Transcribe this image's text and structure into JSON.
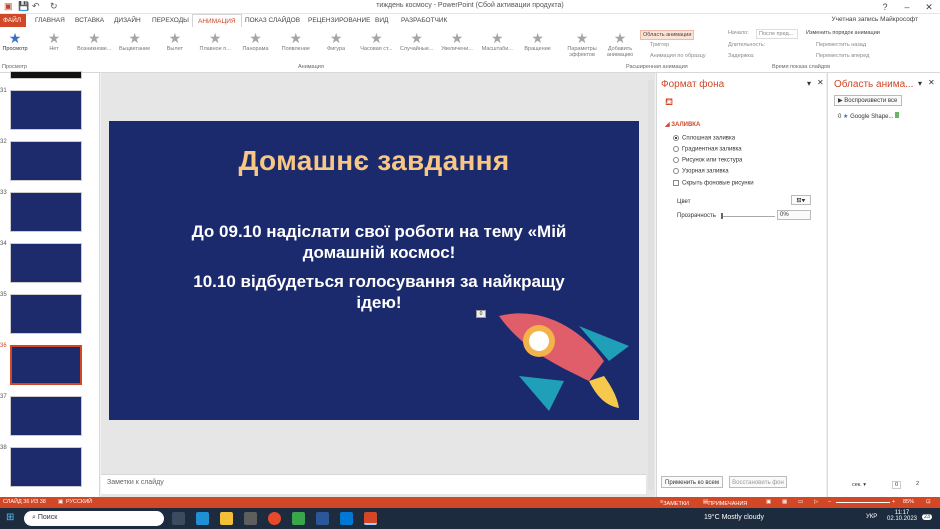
{
  "window": {
    "title": "тиждень космосу - PowerPoint (Сбой активации продукта)",
    "account": "Учетная запись Майкрософт"
  },
  "tabs": [
    "ФАЙЛ",
    "ГЛАВНАЯ",
    "ВСТАВКА",
    "ДИЗАЙН",
    "ПЕРЕХОДЫ",
    "АНИМАЦИЯ",
    "ПОКАЗ СЛАЙДОВ",
    "РЕЦЕНЗИРОВАНИЕ",
    "ВИД",
    "РАЗРАБОТЧИК"
  ],
  "ribbon": {
    "preview_label": "Просмотр",
    "preview_group": "Просмотр",
    "animations": [
      "Нет",
      "Возникнове...",
      "Выцветание",
      "Вылет",
      "Плавное п...",
      "Панорама",
      "Появление",
      "Фигура",
      "Часовая ст...",
      "Случайные...",
      "Увеличени...",
      "Масштаби...",
      "Вращение"
    ],
    "animation_group": "Анимация",
    "effect_params": "Параметры эффектов",
    "add_animation": "Добавить анимацию",
    "anim_pane_btn": "Область анимации",
    "trigger": "Триггер",
    "anim_painter": "Анимация по образцу",
    "advanced_group": "Расширенная анимация",
    "start_label": "Начало:",
    "start_value": "После пред...",
    "duration_label": "Длительность:",
    "delay_label": "Задержка:",
    "reorder_title": "Изменить порядок анимации",
    "move_earlier": "Переместить назад",
    "move_later": "Переместить вперед",
    "timing_group": "Время показа слайдов"
  },
  "thumbnails": [
    {
      "num": "31"
    },
    {
      "num": "32"
    },
    {
      "num": "33"
    },
    {
      "num": "34"
    },
    {
      "num": "35"
    },
    {
      "num": "36"
    },
    {
      "num": "37"
    },
    {
      "num": "38"
    }
  ],
  "slide": {
    "title": "Домашнє завдання",
    "body1": "До 09.10 надіслати свої роботи на тему «Мій домашній космос!",
    "body2": "10.10 відбудеться голосування за найкращу ідею!",
    "anim_marker": "0"
  },
  "notes_placeholder": "Заметки к слайду",
  "format_pane": {
    "title": "Формат фона",
    "section": "ЗАЛИВКА",
    "options": [
      "Сплошная заливка",
      "Градиентная заливка",
      "Рисунок или текстура",
      "Узорная заливка"
    ],
    "hide_bg": "Скрыть фоновые рисунки",
    "color_label": "Цвет",
    "transparency_label": "Прозрачность",
    "transparency_value": "0%",
    "apply_all": "Применить ко всем",
    "reset_bg": "Восстановить фон"
  },
  "anim_pane": {
    "title": "Область анима...",
    "play_all": "Воспроизвести все",
    "item_num": "0",
    "item_label": "Google Shape...",
    "seconds_label": "сек.",
    "timeline_start": "0",
    "timeline_end": "2"
  },
  "status": {
    "slide_of": "СЛАЙД 36 ИЗ 38",
    "language": "РУССКИЙ",
    "notes": "ЗАМЕТКИ",
    "comments": "ПРИМЕЧАНИЯ",
    "zoom": "85%"
  },
  "taskbar": {
    "search": "Поиск",
    "weather": "19°C  Mostly cloudy",
    "lang": "УКР",
    "time": "11:17",
    "date": "02.10.2023",
    "badge": "23"
  }
}
